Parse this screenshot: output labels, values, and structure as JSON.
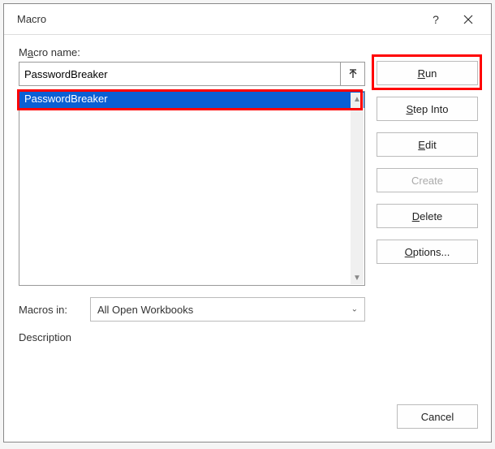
{
  "dialog": {
    "title": "Macro",
    "help_symbol": "?",
    "macro_name_label_pre": "M",
    "macro_name_label_accel": "a",
    "macro_name_label_post": "cro name:",
    "macro_name_value": "PasswordBreaker",
    "list": {
      "items": [
        {
          "label": "PasswordBreaker",
          "selected": true
        }
      ]
    },
    "macros_in_label_pre": "Macros i",
    "macros_in_label_accel": "n",
    "macros_in_label_post": ":",
    "macros_in_value": "All Open Workbooks",
    "description_label": "Description"
  },
  "buttons": {
    "run_accel": "R",
    "run_rest": "un",
    "step_accel": "S",
    "step_rest": "tep Into",
    "edit_accel": "E",
    "edit_rest": "dit",
    "create_label": "Create",
    "delete_accel": "D",
    "delete_rest": "elete",
    "options_accel": "O",
    "options_rest": "ptions...",
    "cancel_label": "Cancel"
  }
}
